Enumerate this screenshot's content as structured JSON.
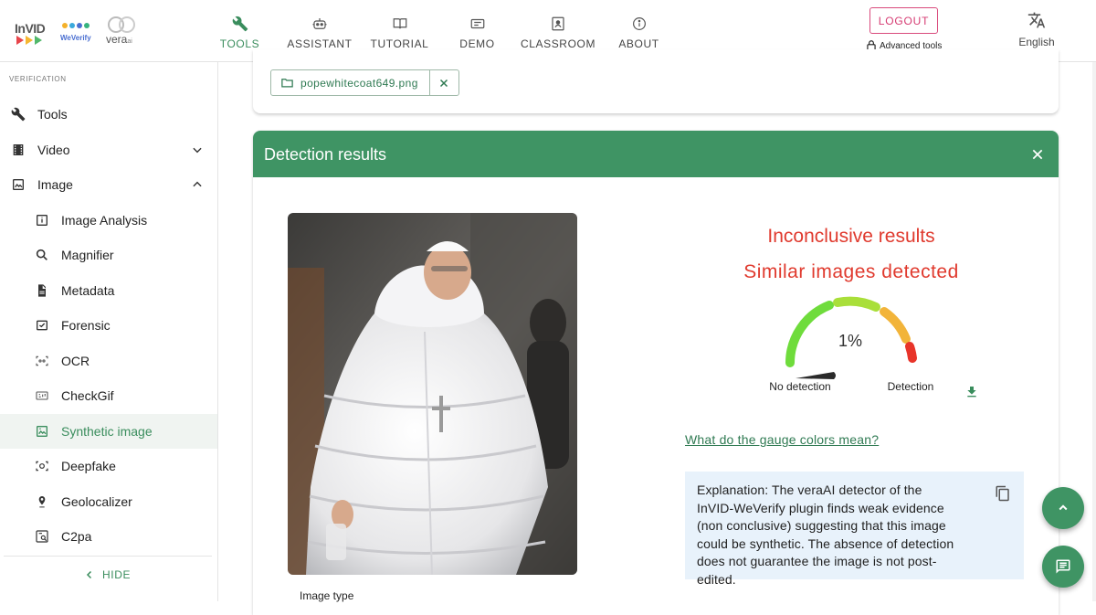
{
  "logos": {
    "invid": "InVID",
    "weverify": "WeVerify",
    "vera": "vera",
    "vera_suffix": "ai"
  },
  "nav": {
    "items": [
      {
        "label": "TOOLS",
        "icon": "wrench-icon",
        "active": true
      },
      {
        "label": "ASSISTANT",
        "icon": "robot-icon"
      },
      {
        "label": "TUTORIAL",
        "icon": "book-icon"
      },
      {
        "label": "DEMO",
        "icon": "video-icon"
      },
      {
        "label": "CLASSROOM",
        "icon": "classroom-icon"
      },
      {
        "label": "ABOUT",
        "icon": "info-icon"
      }
    ],
    "logout": "LOGOUT",
    "advanced_tools": "Advanced tools",
    "language": "English"
  },
  "sidebar": {
    "section": "VERIFICATION",
    "items": [
      {
        "label": "Tools",
        "icon": "wrench-icon"
      },
      {
        "label": "Video",
        "icon": "film-icon",
        "expand": "chevron-down"
      },
      {
        "label": "Image",
        "icon": "image-icon",
        "expand": "chevron-up"
      }
    ],
    "image_tools": [
      {
        "label": "Image Analysis",
        "icon": "analysis-icon"
      },
      {
        "label": "Magnifier",
        "icon": "magnifier-icon"
      },
      {
        "label": "Metadata",
        "icon": "document-icon"
      },
      {
        "label": "Forensic",
        "icon": "forensic-icon"
      },
      {
        "label": "OCR",
        "icon": "ocr-icon"
      },
      {
        "label": "CheckGif",
        "icon": "gif-icon"
      },
      {
        "label": "Synthetic image",
        "icon": "synthetic-icon",
        "active": true
      },
      {
        "label": "Deepfake",
        "icon": "deepfake-icon"
      },
      {
        "label": "Geolocalizer",
        "icon": "location-pin-icon"
      },
      {
        "label": "C2pa",
        "icon": "c2pa-icon"
      }
    ],
    "hide": "HIDE"
  },
  "upload": {
    "filename": "popewhitecoat649.png"
  },
  "results": {
    "title": "Detection results",
    "verdict_primary": "Inconclusive results",
    "verdict_secondary": "Similar images detected",
    "gauge_value": "1%",
    "gauge_percent": 1,
    "gauge_low_label": "No detection",
    "gauge_high_label": "Detection",
    "gauge_colors": [
      "#6fdc3c",
      "#a9df3a",
      "#f2b43a",
      "#e8342a"
    ],
    "gauge_link": "What do the gauge colors mean?",
    "explanation": "Explanation: The veraAI detector of the InVID-WeVerify plugin finds weak evidence (non conclusive) suggesting that this image could be synthetic. The absence of detection does not guarantee the image is not post-edited.",
    "image_type_label": "Image type"
  },
  "colors": {
    "brand_green": "#3f9464",
    "active_text": "#3a8d5d",
    "verdict_red": "#e03a2e",
    "logout_pink": "#d63c73",
    "explain_bg": "#e8f2fb"
  }
}
